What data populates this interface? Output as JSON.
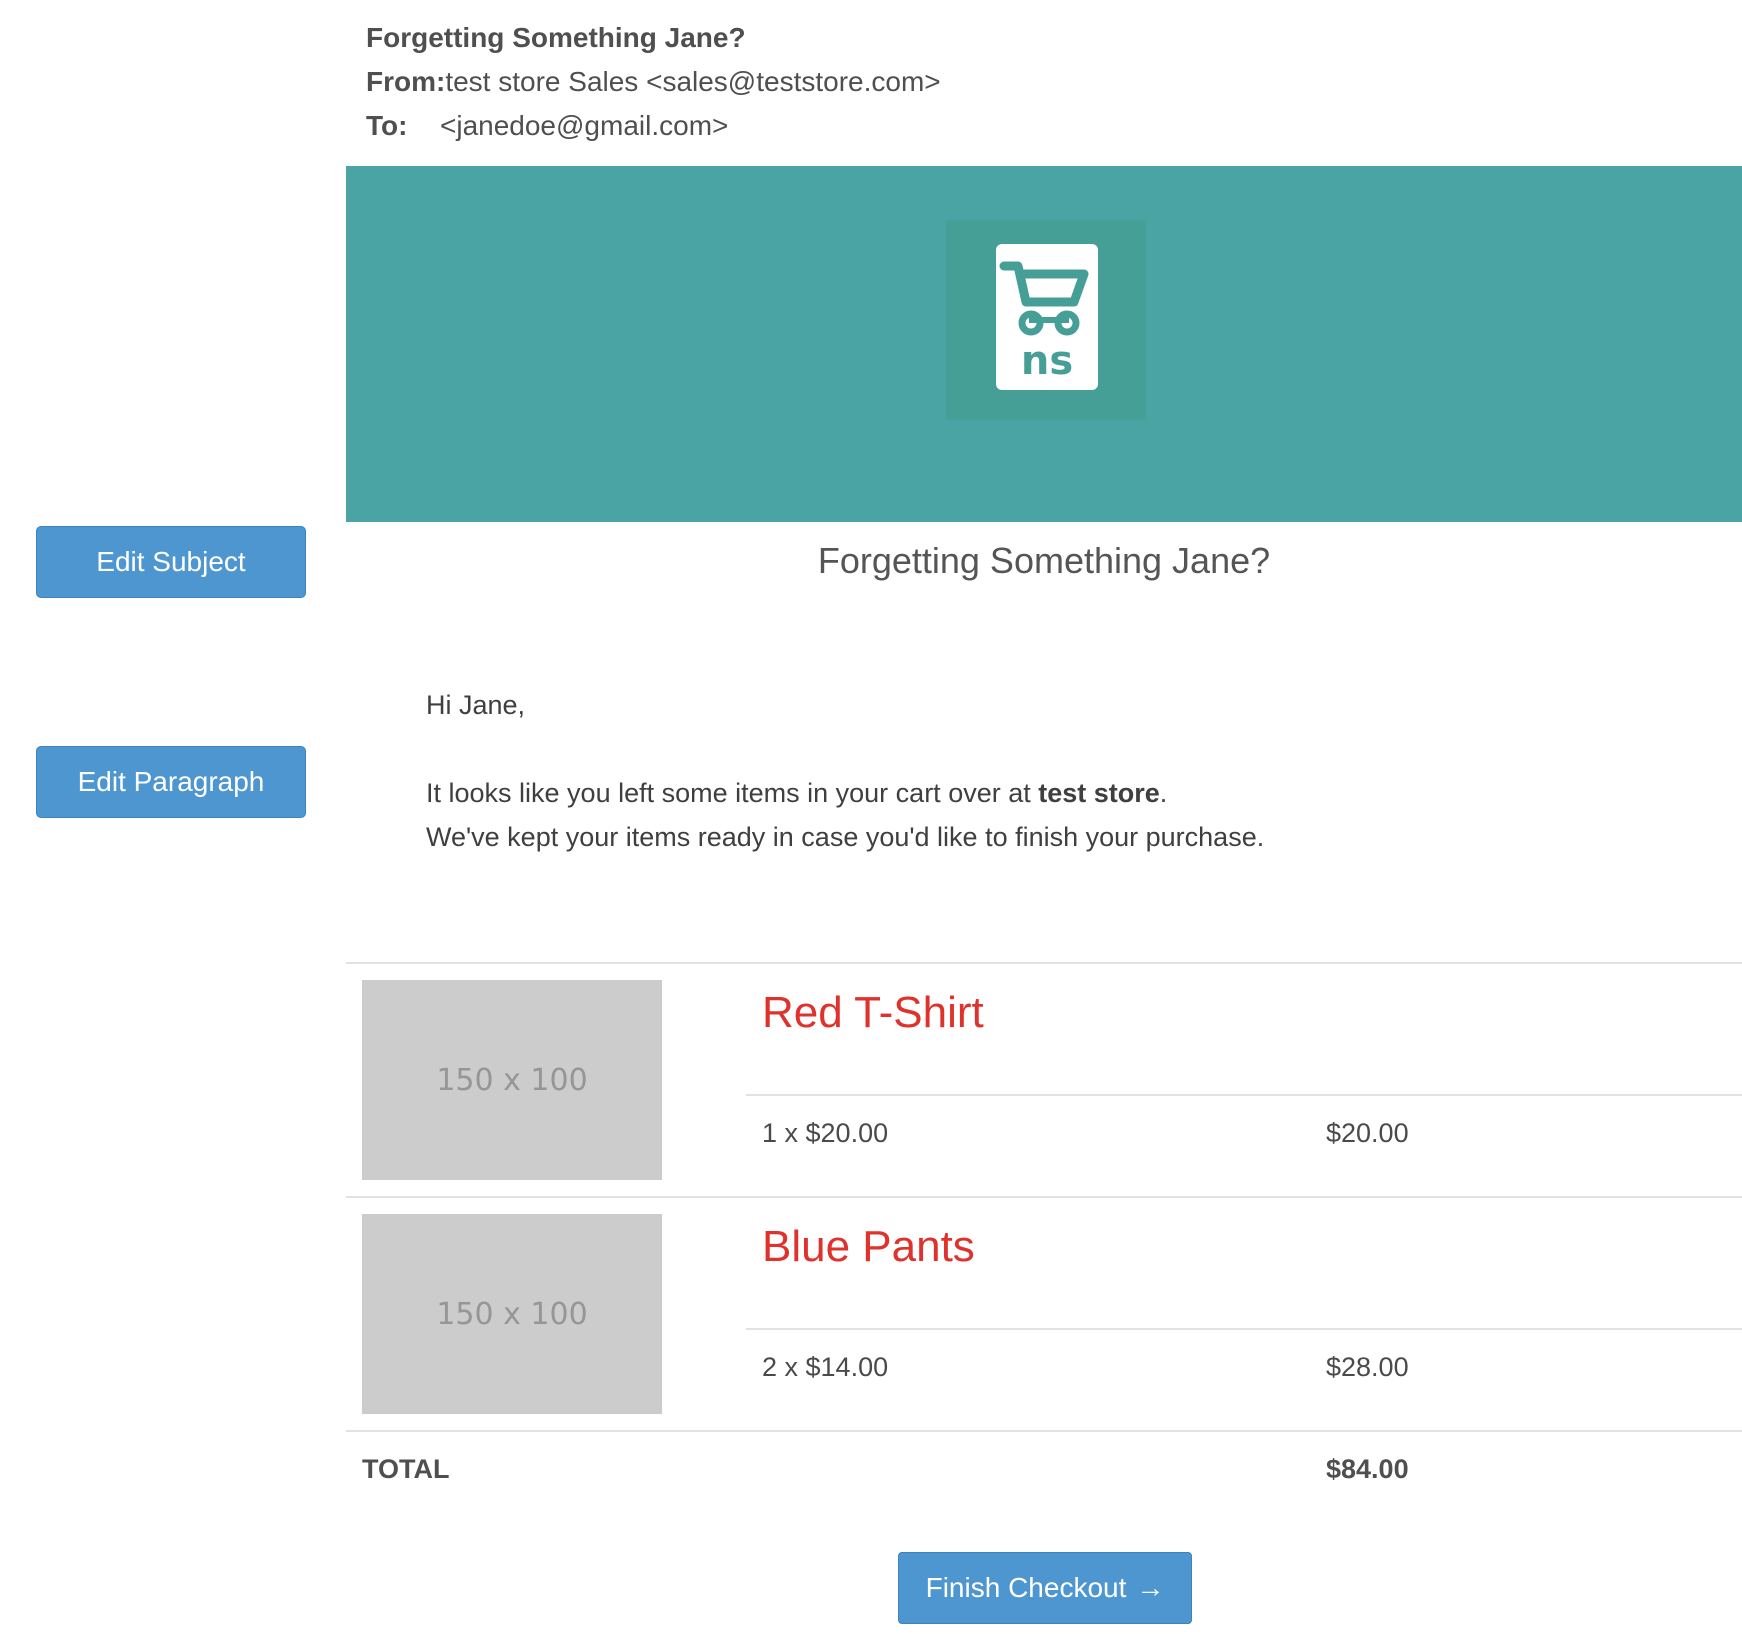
{
  "email": {
    "subject": "Forgetting Something Jane?",
    "from_label": "From:",
    "from_value": "test store Sales <sales@teststore.com>",
    "to_label": "To:",
    "to_value": "<janedoe@gmail.com>"
  },
  "editor": {
    "edit_subject": "Edit Subject",
    "edit_paragraph": "Edit Paragraph"
  },
  "banner": {
    "color": "#4ba4a4",
    "logo_color": "#469f96",
    "logo_icon": "shopping-cart-icon",
    "logo_text": "ns"
  },
  "body": {
    "title": "Forgetting Something Jane?",
    "greeting": "Hi Jane,",
    "line1_pre": "It looks like you left some items in your cart over at ",
    "line1_store": "test store",
    "line1_post": ".",
    "line2": "We've kept your items ready in case you'd like to finish your purchase."
  },
  "cart": {
    "items": [
      {
        "image_placeholder": "150 x 100",
        "name": "Red T-Shirt",
        "qty_price": "1 x $20.00",
        "line_total": "$20.00"
      },
      {
        "image_placeholder": "150 x 100",
        "name": "Blue Pants",
        "qty_price": "2 x $14.00",
        "line_total": "$28.00"
      }
    ],
    "total_label": "TOTAL",
    "total_value": "$84.00"
  },
  "cta": {
    "label": "Finish Checkout",
    "arrow": "→",
    "color": "#4e96cf"
  },
  "accent": {
    "product_name_color": "#e0322c"
  }
}
